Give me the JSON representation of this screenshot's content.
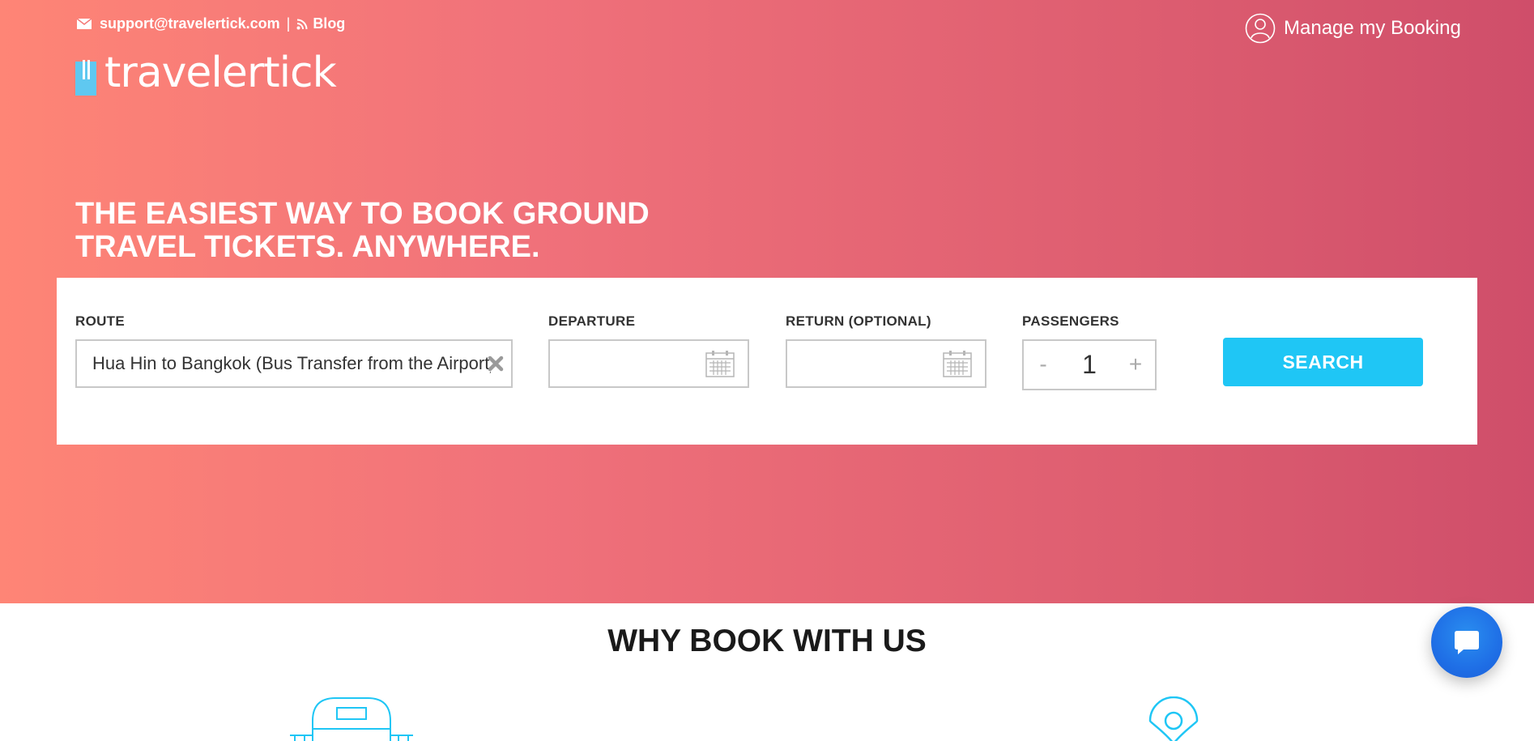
{
  "header": {
    "email": "support@travelertick.com",
    "separator": "|",
    "blog_label": "Blog",
    "manage_booking_label": "Manage my Booking",
    "logo_text": "travelertick"
  },
  "hero": {
    "headline_line1": "THE EASIEST WAY TO BOOK GROUND",
    "headline_line2": "TRAVEL TICKETS. ANYWHERE."
  },
  "search": {
    "route_label": "ROUTE",
    "route_value": "Hua Hin to Bangkok (Bus Transfer from the Airport)",
    "departure_label": "DEPARTURE",
    "departure_value": "",
    "return_label": "RETURN (OPTIONAL)",
    "return_value": "",
    "passengers_label": "PASSENGERS",
    "passengers_minus": "-",
    "passengers_value": "1",
    "passengers_plus": "+",
    "search_button": "SEARCH"
  },
  "why": {
    "title": "WHY BOOK WITH US"
  },
  "icons": {
    "mail": "mail-icon",
    "rss": "rss-icon",
    "user": "user-icon",
    "clear": "clear-icon",
    "calendar": "calendar-icon",
    "chat": "chat-icon",
    "feature_bus": "bus-icon",
    "feature_location": "location-pin-icon"
  },
  "colors": {
    "hero_start": "#fe8576",
    "hero_end": "#cf4e6a",
    "accent": "#1fc6f5",
    "chat": "#1f6fe6"
  }
}
